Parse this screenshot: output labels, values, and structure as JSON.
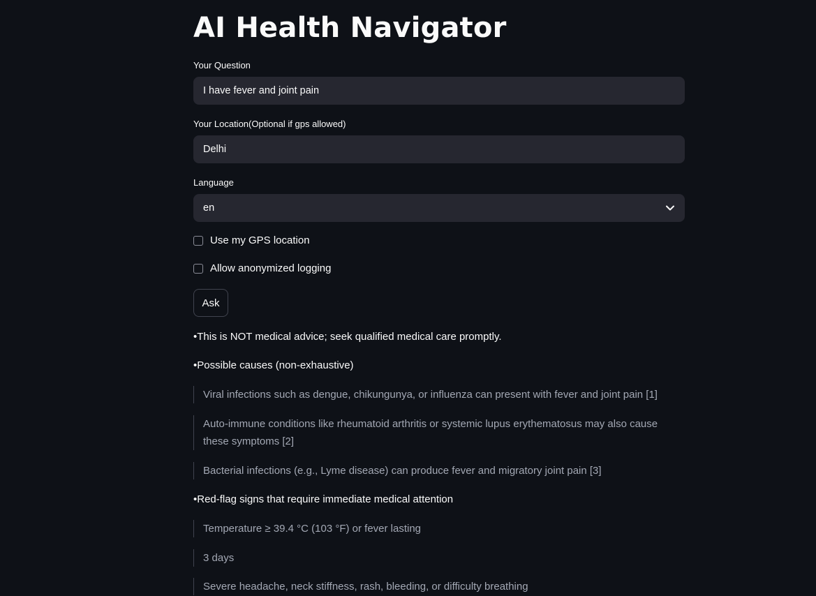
{
  "app": {
    "title": "AI Health Navigator"
  },
  "form": {
    "question_label": "Your Question",
    "question_value": "I have fever and joint pain",
    "location_label": "Your Location(Optional if gps allowed)",
    "location_value": "Delhi",
    "language_label": "Language",
    "language_value": "en",
    "gps_label": "Use my GPS location",
    "logging_label": "Allow anonymized logging",
    "ask_label": "Ask"
  },
  "response": {
    "disclaimer": "•This is NOT medical advice; seek qualified medical care promptly.",
    "causes_heading": "•Possible causes (non-exhaustive)",
    "causes": [
      "Viral infections such as dengue, chikungunya, or influenza can present with fever and joint pain [1]",
      "Auto-immune conditions like rheumatoid arthritis or systemic lupus erythematosus may also cause these symptoms [2]",
      "Bacterial infections (e.g., Lyme disease) can produce fever and migratory joint pain [3]"
    ],
    "redflag_heading": "•Red-flag signs that require immediate medical attention",
    "redflags": [
      "Temperature ≥ 39.4 °C (103 °F) or fever lasting",
      "3 days",
      "Severe headache, neck stiffness, rash, bleeding, or difficulty breathing"
    ]
  },
  "icons": {
    "dropdown": "chevron-down-icon"
  },
  "colors": {
    "background": "#0e1117",
    "input_bg": "#262730",
    "text": "#fafafa",
    "muted_text": "#a3a8b4",
    "border": "#41444f"
  }
}
